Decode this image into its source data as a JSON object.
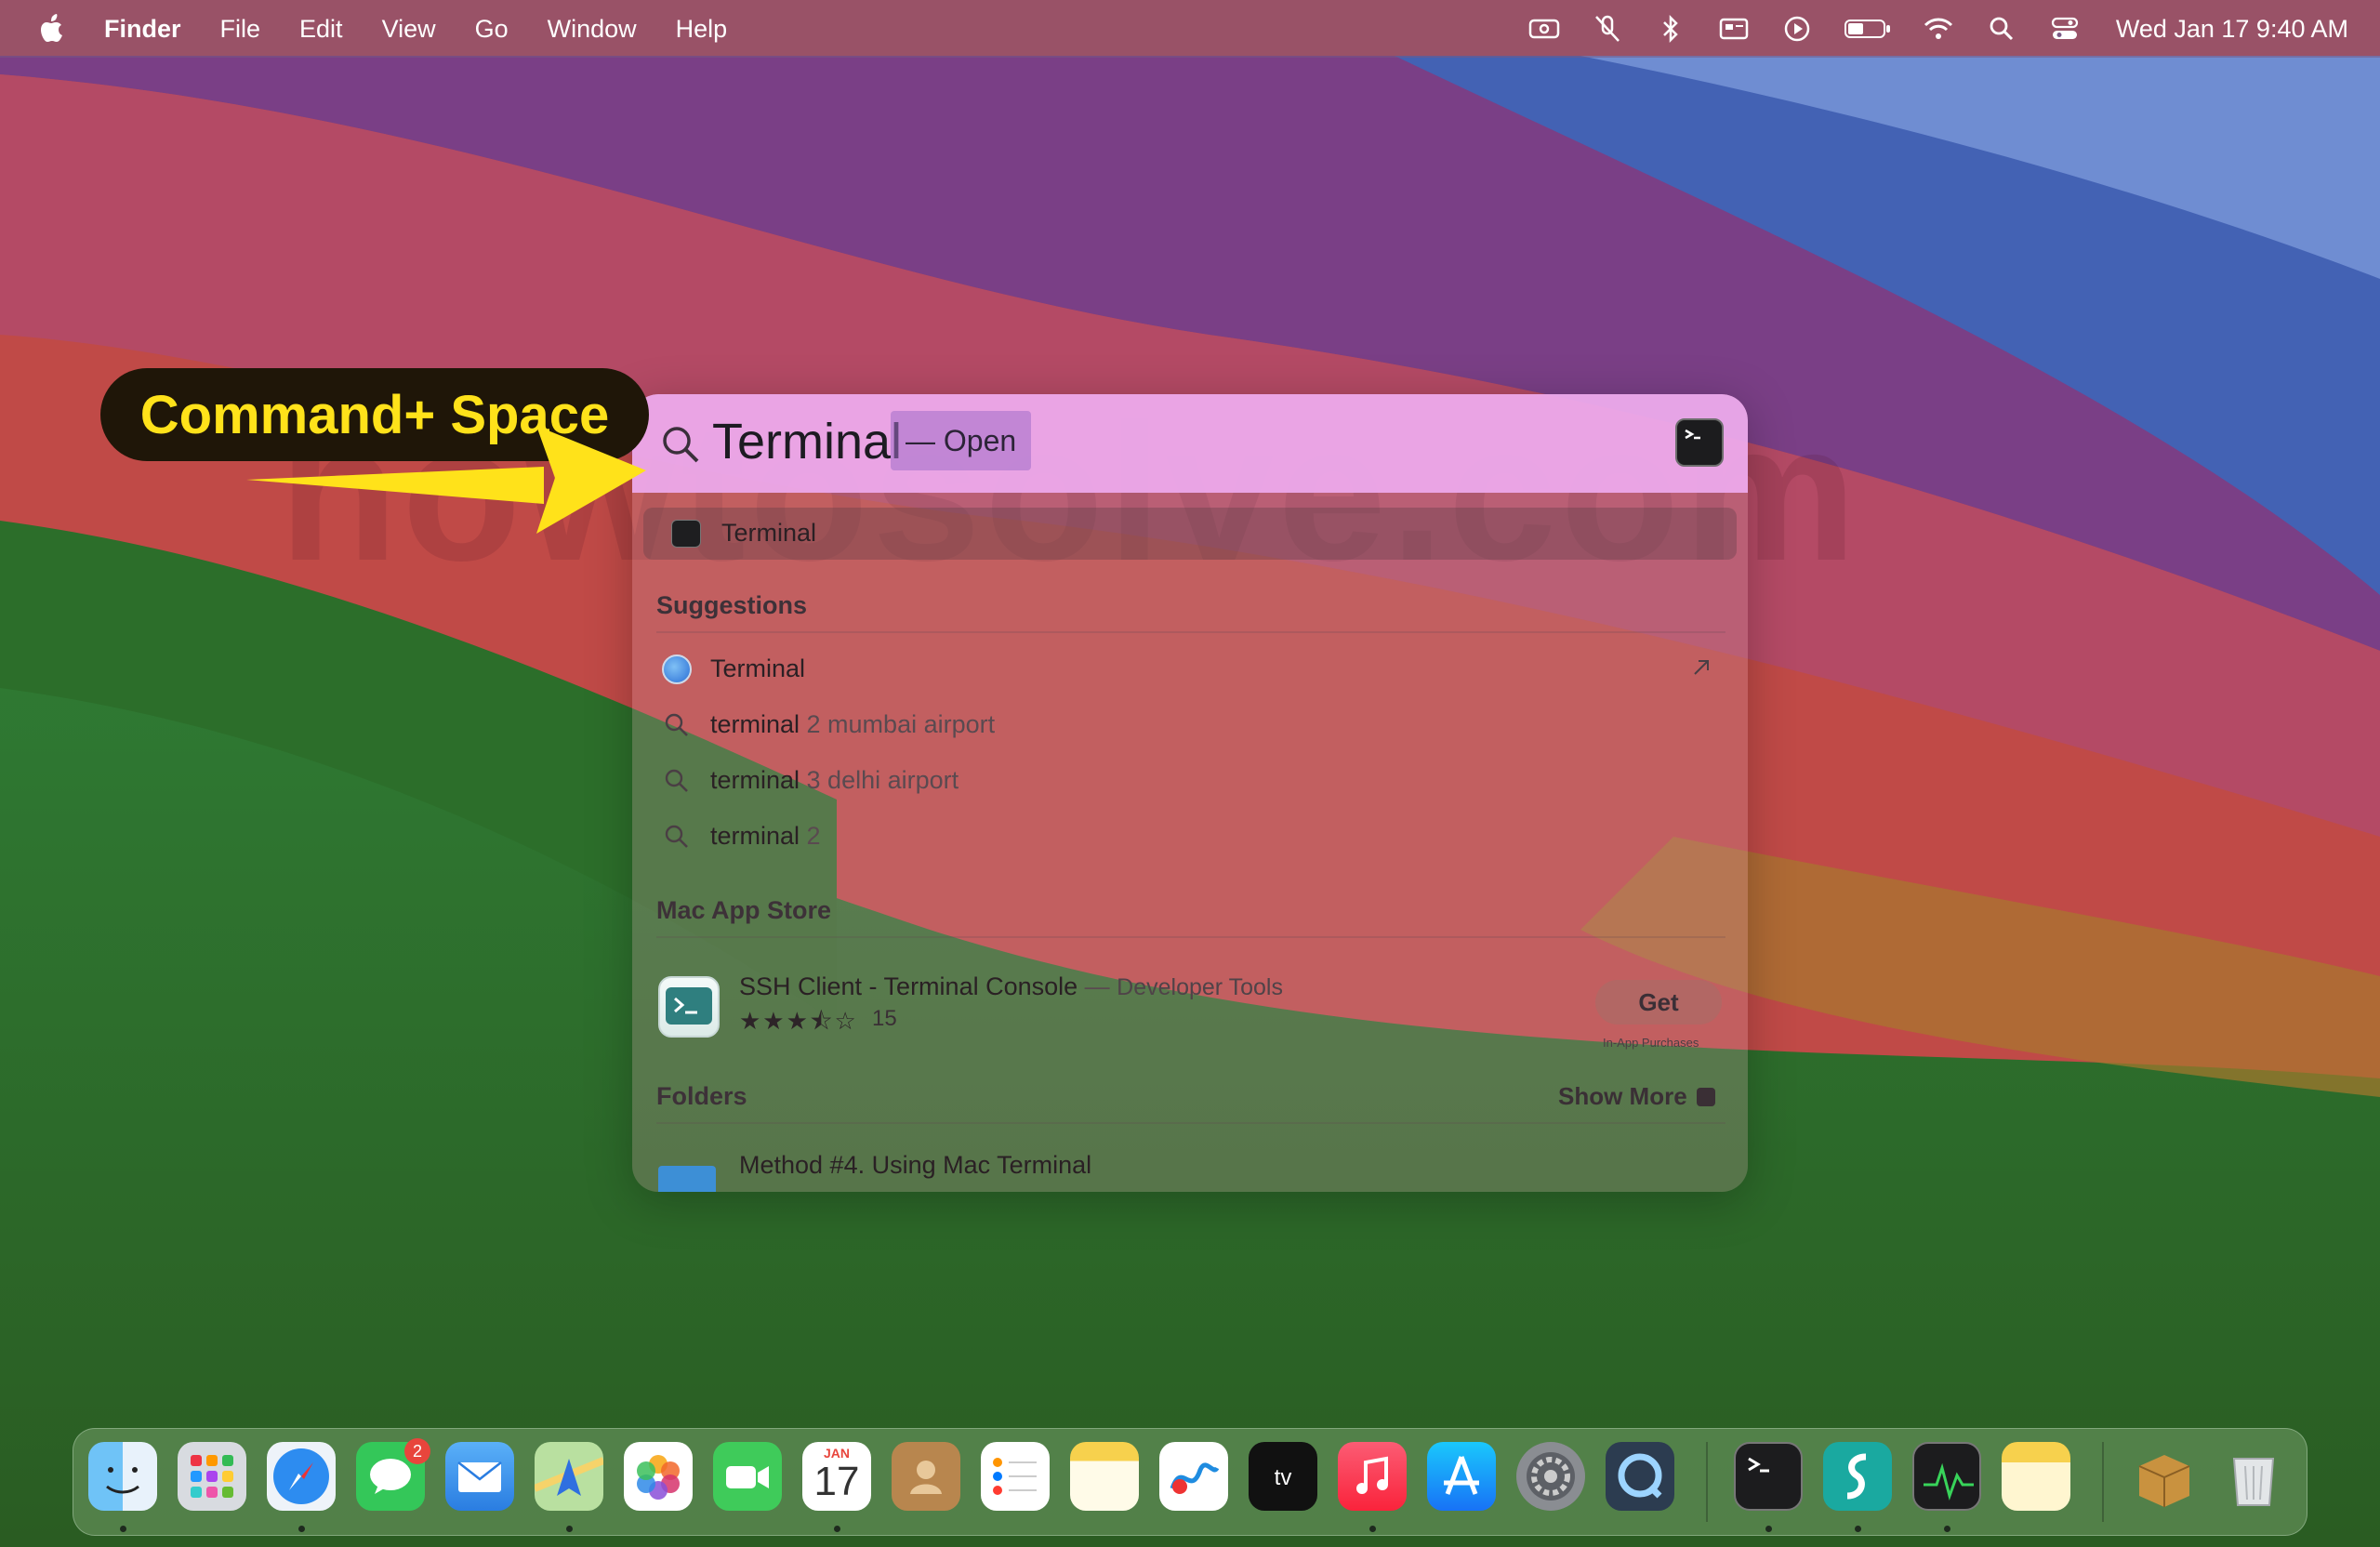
{
  "menubar": {
    "app_name": "Finder",
    "menus": [
      "File",
      "Edit",
      "View",
      "Go",
      "Window",
      "Help"
    ],
    "clock": "Wed Jan 17  9:40 AM",
    "status_icons": [
      "screen-mirroring-icon",
      "mic-off-icon",
      "bluetooth-icon",
      "display-icon",
      "play-icon",
      "battery-icon",
      "wifi-icon",
      "spotlight-search-icon",
      "control-center-icon"
    ]
  },
  "annotation": {
    "label": "Command+ Space",
    "color": "#ffe21a"
  },
  "spotlight": {
    "query": "Terminal",
    "completion": "— Open",
    "top_hit": "Terminal",
    "suggestions": {
      "title": "Suggestions",
      "items": [
        {
          "prefix": "Terminal",
          "rest": "",
          "icon": "safari-icon"
        },
        {
          "prefix": "terminal",
          "rest": " 2 mumbai airport",
          "icon": "search-icon"
        },
        {
          "prefix": "terminal",
          "rest": " 3 delhi airport",
          "icon": "search-icon"
        },
        {
          "prefix": "terminal",
          "rest": " 2",
          "icon": "search-icon"
        }
      ]
    },
    "app_store": {
      "title": "Mac App Store",
      "app_name": "SSH Client - Terminal Console",
      "separator": " — ",
      "category": "Developer Tools",
      "stars": "★★★⯪☆",
      "rating_count": "15",
      "get_label": "Get",
      "iap_note": "In-App Purchases"
    },
    "folders": {
      "title": "Folders",
      "show_more": "Show More",
      "item": "Method #4. Using Mac Terminal"
    }
  },
  "watermark": "howtosolve.com",
  "dock": {
    "apps": [
      "Finder",
      "Launchpad",
      "Safari",
      "Messages",
      "Mail",
      "Maps",
      "Photos",
      "FaceTime",
      "Calendar",
      "Contacts",
      "Reminders",
      "Notes",
      "Freeform",
      "TV",
      "Music",
      "App Store",
      "System Settings",
      "QuickTime Player",
      "Terminal",
      "Surfshark",
      "Activity Monitor",
      "Notes Folder",
      "Archive Utility",
      "Trash"
    ],
    "messages_badge": "2",
    "calendar_month": "JAN",
    "calendar_day": "17"
  }
}
